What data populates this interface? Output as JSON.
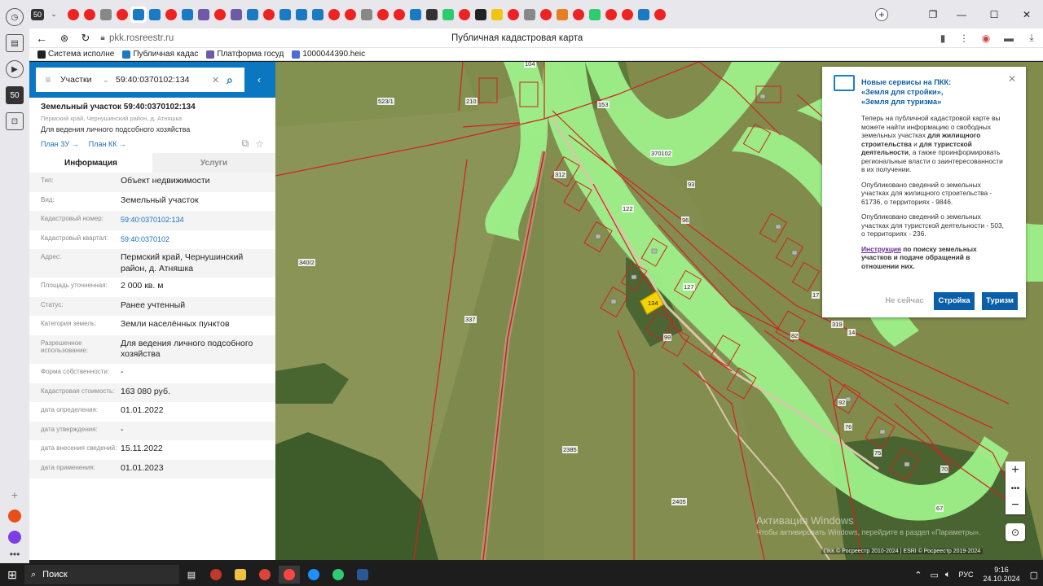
{
  "browser": {
    "tab_counter": "50",
    "url": "pkk.rosreestr.ru",
    "page_title": "Публичная кадастровая карта",
    "bookmarks": [
      {
        "label": "Система исполне",
        "icon": "system-icon"
      },
      {
        "label": "Публичная кадас",
        "icon": "rosreestr-icon"
      },
      {
        "label": "Платформа госуд",
        "icon": "eagle-icon"
      },
      {
        "label": "1000044390.heic",
        "icon": "image-icon"
      }
    ]
  },
  "panel": {
    "search": {
      "category": "Участки",
      "query": "59:40:0370102:134"
    },
    "object": {
      "title": "Земельный участок 59:40:0370102:134",
      "address_short": "Пермский край, Чернушинский район, д. Атняшка",
      "usage": "Для ведения личного подсобного хозяйства",
      "plan_zu": "План ЗУ →",
      "plan_kk": "План КК →"
    },
    "tabs": {
      "info": "Информация",
      "services": "Услуги"
    },
    "properties": [
      {
        "label": "Тип:",
        "value": "Объект недвижимости"
      },
      {
        "label": "Вид:",
        "value": "Земельный участок"
      },
      {
        "label": "Кадастровый номер:",
        "value": "59:40:0370102:134",
        "link": true
      },
      {
        "label": "Кадастровый квартал:",
        "value": "59:40:0370102",
        "link": true
      },
      {
        "label": "Адрес:",
        "value": "Пермский край, Чернушинский район, д. Атняшка"
      },
      {
        "label": "Площадь уточненная:",
        "value": "2 000 кв. м"
      },
      {
        "label": "Статус:",
        "value": "Ранее учтенный"
      },
      {
        "label": "Категория земель:",
        "value": "Земли населённых пунктов"
      },
      {
        "label": "Разрешенное использование:",
        "value": "Для ведения личного подсобного хозяйства"
      },
      {
        "label": "Форма собственности:",
        "value": "-"
      },
      {
        "label": "Кадастровая стоимость:",
        "value": "163 080 руб."
      },
      {
        "label": "дата определения:",
        "value": "01.01.2022"
      },
      {
        "label": "дата утверждения:",
        "value": "-"
      },
      {
        "label": "дата внесения сведений:",
        "value": "15.11.2022"
      },
      {
        "label": "дата применения:",
        "value": "01.01.2023"
      }
    ]
  },
  "map": {
    "parcel_labels": [
      {
        "t": "104"
      },
      {
        "t": "523/1"
      },
      {
        "t": "210"
      },
      {
        "t": "153"
      },
      {
        "t": "370102"
      },
      {
        "t": "312"
      },
      {
        "t": "122"
      },
      {
        "t": "93"
      },
      {
        "t": "96"
      },
      {
        "t": "340/2"
      },
      {
        "t": "337"
      },
      {
        "t": "134"
      },
      {
        "t": "127"
      },
      {
        "t": "2385"
      },
      {
        "t": "2405"
      },
      {
        "t": "14"
      },
      {
        "t": "92"
      },
      {
        "t": "76"
      },
      {
        "t": "75"
      },
      {
        "t": "70"
      },
      {
        "t": "67"
      },
      {
        "t": "17"
      },
      {
        "t": "319"
      },
      {
        "t": "82"
      },
      {
        "t": "99"
      }
    ],
    "watermark_title": "Активация Windows",
    "watermark_text": "Чтобы активировать Windows, перейдите в раздел «Параметры».",
    "attribution": "ПКК © Росреестр 2010-2024 | ESRI © Росреестр 2019-2024"
  },
  "popup": {
    "heading1": "Новые сервисы на ПКК:",
    "heading2": "«Земля для стройки»,",
    "heading3": "«Земля для туризма»",
    "p1a": "Теперь на публичной кадастровой карте вы можете найти информацию о свободных земельных участках ",
    "p1b": "для жилищного строительства",
    "p1c": " и ",
    "p1d": "для туристской деятельности",
    "p1e": ", а также проинформировать региональные власти о заинтересованности в их получении.",
    "p2": "Опубликовано сведений о земельных участках для жилищного строительства - 61736, о территориях - 9846.",
    "p3": "Опубликовано сведений о земельных участках для туристской деятельности - 503, о территориях - 236.",
    "p4a": "Инструкция",
    "p4b": " по поиску земельных участков и подаче обращений в отношении них.",
    "btn_later": "Не сейчас",
    "btn_build": "Стройка",
    "btn_tourism": "Туризм"
  },
  "taskbar": {
    "search_label": "Поиск",
    "lang": "РУС",
    "time": "9:16",
    "date": "24.10.2024"
  },
  "colors": {
    "accent": "#0b77c1",
    "green_zone": "#90ee90",
    "parcel_border": "#d42020",
    "selected_parcel": "#f5d300"
  }
}
